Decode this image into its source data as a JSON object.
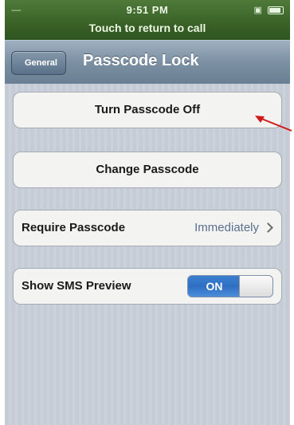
{
  "status_bar": {
    "time": "9:51 PM",
    "call_banner": "Touch to return to call",
    "signal": "-----"
  },
  "nav": {
    "back_label": "General",
    "title": "Passcode Lock"
  },
  "buttons": {
    "turn_off_label": "Turn Passcode Off",
    "change_label": "Change Passcode"
  },
  "require_passcode": {
    "label": "Require Passcode",
    "value": "Immediately"
  },
  "sms_preview": {
    "label": "Show SMS Preview",
    "toggle_state": "ON"
  },
  "annotation": {
    "arrow_color": "#d01818"
  },
  "colors": {
    "status_bar_green": "#3a6127",
    "nav_bar_blue_gray": "#7c90a3",
    "toggle_blue": "#2f6fc2"
  },
  "icons": [
    "lock-icon",
    "battery-icon",
    "chevron-right-icon"
  ]
}
